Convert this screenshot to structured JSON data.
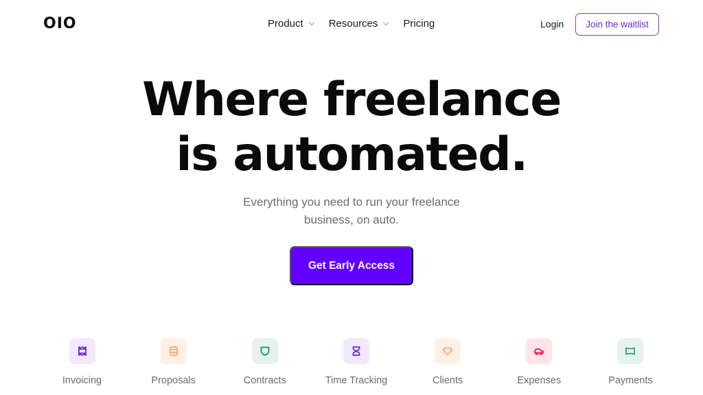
{
  "nav": {
    "logo": "OIO",
    "links": [
      {
        "label": "Product",
        "has_dropdown": true
      },
      {
        "label": "Resources",
        "has_dropdown": true
      },
      {
        "label": "Pricing",
        "has_dropdown": false
      }
    ],
    "login_label": "Login",
    "waitlist_label": "Join the waitlist"
  },
  "hero": {
    "title_line1": "Where freelance",
    "title_line2": "is automated.",
    "subtitle_line1": "Everything you need to run your freelance",
    "subtitle_line2": "business, on auto.",
    "cta_label": "Get Early Access"
  },
  "colors": {
    "brand": "#6200ff",
    "outline": "#7c3aed"
  },
  "features": [
    {
      "label": "Invoicing",
      "icon": "receipt-icon",
      "bg": "#f1e9ff",
      "fg": "#6d28d9"
    },
    {
      "label": "Proposals",
      "icon": "document-lines-icon",
      "bg": "#fff0e6",
      "fg": "#f59e5b"
    },
    {
      "label": "Contracts",
      "icon": "shield-icon",
      "bg": "#e6f2ee",
      "fg": "#15946b"
    },
    {
      "label": "Time Tracking",
      "icon": "hourglass-icon",
      "bg": "#f1e9ff",
      "fg": "#6d28d9"
    },
    {
      "label": "Clients",
      "icon": "diamond-icon",
      "bg": "#fff0e6",
      "fg": "#f59e5b"
    },
    {
      "label": "Expenses",
      "icon": "car-icon",
      "bg": "#ffe4e8",
      "fg": "#e11d48"
    },
    {
      "label": "Payments",
      "icon": "flag-icon",
      "bg": "#e6f2ee",
      "fg": "#15946b"
    }
  ]
}
